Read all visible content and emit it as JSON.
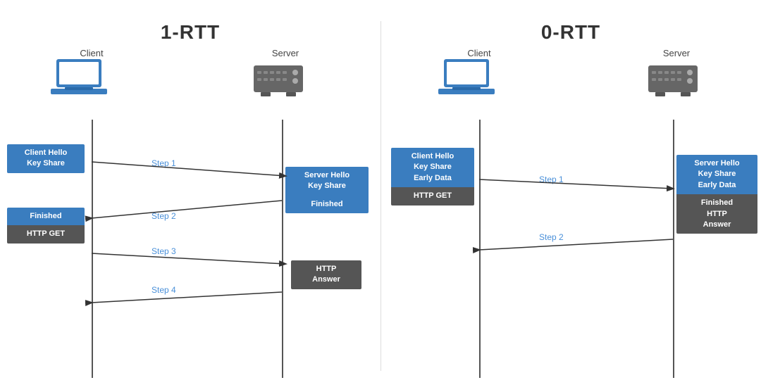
{
  "left": {
    "title": "1-RTT",
    "client_label": "Client",
    "server_label": "Server",
    "client_msgs": [
      {
        "lines": [
          "Client Hello",
          "Key Share"
        ],
        "type": "blue"
      },
      {
        "lines": [
          "Finished",
          "HTTP GET"
        ],
        "type": "blue_dark"
      }
    ],
    "server_msgs": [
      {
        "lines": [
          "Server Hello",
          "Key Share"
        ],
        "type": "blue"
      },
      {
        "lines": [
          "Finished"
        ],
        "type": "blue"
      },
      {
        "lines": [
          "HTTP",
          "Answer"
        ],
        "type": "dark"
      }
    ],
    "steps": [
      "Step 1",
      "Step 2",
      "Step 3",
      "Step 4"
    ]
  },
  "right": {
    "title": "0-RTT",
    "client_label": "Client",
    "server_label": "Server",
    "client_msgs": [
      {
        "lines": [
          "Client Hello",
          "Key Share",
          "Early Data",
          "HTTP GET"
        ],
        "type": "blue_dark"
      }
    ],
    "server_msgs": [
      {
        "lines": [
          "Server Hello",
          "Key Share",
          "Early Data"
        ],
        "type": "blue"
      },
      {
        "lines": [
          "Finished",
          "HTTP",
          "Answer"
        ],
        "type": "dark"
      }
    ],
    "steps": [
      "Step 1",
      "Step 2"
    ]
  }
}
